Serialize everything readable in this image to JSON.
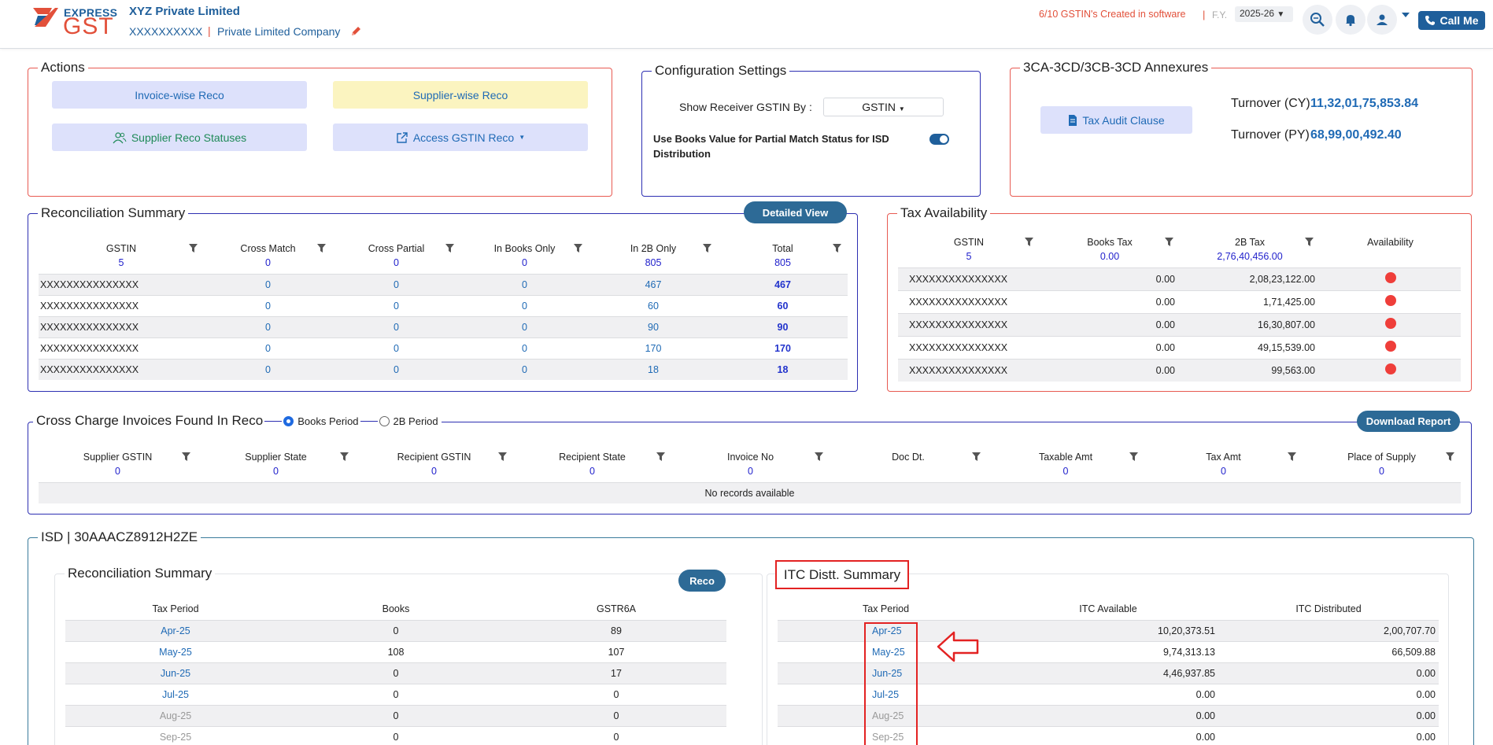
{
  "header": {
    "logo_express": "EXPRESS",
    "logo_gst": "GST",
    "company_name": "XYZ Private Limited",
    "company_id": "XXXXXXXXXX",
    "company_sep": "|",
    "company_type": "Private Limited Company",
    "gstin_created": "6/10 GSTIN's Created in software",
    "sep": "|",
    "fy_label": "F.Y.",
    "fy_value": "2025-26",
    "call_me": "Call Me",
    "colors": {
      "brand_blue": "#1f5f9b",
      "brand_red": "#e2503a"
    }
  },
  "actions": {
    "legend": "Actions",
    "invoice_wise": "Invoice-wise Reco",
    "supplier_wise": "Supplier-wise Reco",
    "supplier_statuses": "Supplier Reco Statuses",
    "access_gstin": "Access GSTIN Reco"
  },
  "config": {
    "legend": "Configuration Settings",
    "receiver_label": "Show Receiver GSTIN By :",
    "receiver_value": "GSTIN",
    "books_value_label": "Use Books Value for Partial Match Status for ISD Distribution",
    "books_value_enabled": true
  },
  "annex": {
    "legend": "3CA-3CD/3CB-3CD Annexures",
    "tax_audit_btn": "Tax Audit Clause",
    "turnover_cy_label": "Turnover (CY)",
    "turnover_cy_value": "11,32,01,75,853.84",
    "turnover_py_label": "Turnover (PY)",
    "turnover_py_value": "68,99,00,492.40"
  },
  "reco_summary": {
    "legend": "Reconciliation Summary",
    "detailed_view": "Detailed View",
    "headers": [
      "GSTIN",
      "Cross Match",
      "Cross Partial",
      "In Books Only",
      "In 2B Only",
      "Total"
    ],
    "counts": [
      "5",
      "0",
      "0",
      "0",
      "805",
      "805"
    ],
    "rows": [
      [
        "XXXXXXXXXXXXXXX",
        "0",
        "0",
        "0",
        "467",
        "467"
      ],
      [
        "XXXXXXXXXXXXXXX",
        "0",
        "0",
        "0",
        "60",
        "60"
      ],
      [
        "XXXXXXXXXXXXXXX",
        "0",
        "0",
        "0",
        "90",
        "90"
      ],
      [
        "XXXXXXXXXXXXXXX",
        "0",
        "0",
        "0",
        "170",
        "170"
      ],
      [
        "XXXXXXXXXXXXXXX",
        "0",
        "0",
        "0",
        "18",
        "18"
      ]
    ]
  },
  "tax_avail": {
    "legend": "Tax Availability",
    "headers": [
      "GSTIN",
      "Books Tax",
      "2B Tax",
      "Availability"
    ],
    "counts": [
      "5",
      "0.00",
      "2,76,40,456.00",
      ""
    ],
    "rows": [
      [
        "XXXXXXXXXXXXXXX",
        "0.00",
        "2,08,23,122.00"
      ],
      [
        "XXXXXXXXXXXXXXX",
        "0.00",
        "1,71,425.00"
      ],
      [
        "XXXXXXXXXXXXXXX",
        "0.00",
        "16,30,807.00"
      ],
      [
        "XXXXXXXXXXXXXXX",
        "0.00",
        "49,15,539.00"
      ],
      [
        "XXXXXXXXXXXXXXX",
        "0.00",
        "99,563.00"
      ]
    ],
    "status_color": "#ef3e3a"
  },
  "cross_charge": {
    "legend": "Cross Charge Invoices Found In Reco",
    "opt_books": "Books Period",
    "opt_2b": "2B Period",
    "selected": "Books Period",
    "download": "Download Report",
    "headers": [
      "Supplier GSTIN",
      "Supplier State",
      "Recipient GSTIN",
      "Recipient State",
      "Invoice No",
      "Doc Dt.",
      "Taxable Amt",
      "Tax Amt",
      "Place of Supply"
    ],
    "counts": [
      "0",
      "0",
      "0",
      "0",
      "0",
      "",
      "0",
      "0",
      "0"
    ],
    "empty": "No records available"
  },
  "isd": {
    "legend": "ISD | 30AAACZ8912H2ZE",
    "reco": {
      "legend": "Reconciliation Summary",
      "reco_btn": "Reco",
      "headers": [
        "Tax Period",
        "Books",
        "GSTR6A"
      ],
      "rows": [
        [
          "Apr-25",
          "0",
          "89"
        ],
        [
          "May-25",
          "108",
          "107"
        ],
        [
          "Jun-25",
          "0",
          "17"
        ],
        [
          "Jul-25",
          "0",
          "0"
        ],
        [
          "Aug-25",
          "0",
          "0"
        ],
        [
          "Sep-25",
          "0",
          "0"
        ]
      ]
    },
    "itc": {
      "legend": "ITC Distt. Summary",
      "headers": [
        "Tax Period",
        "ITC Available",
        "ITC Distributed"
      ],
      "rows": [
        [
          "Apr-25",
          "10,20,373.51",
          "2,00,707.70"
        ],
        [
          "May-25",
          "9,74,313.13",
          "66,509.88"
        ],
        [
          "Jun-25",
          "4,46,937.85",
          "0.00"
        ],
        [
          "Jul-25",
          "0.00",
          "0.00"
        ],
        [
          "Aug-25",
          "0.00",
          "0.00"
        ],
        [
          "Sep-25",
          "0.00",
          "0.00"
        ]
      ]
    }
  }
}
